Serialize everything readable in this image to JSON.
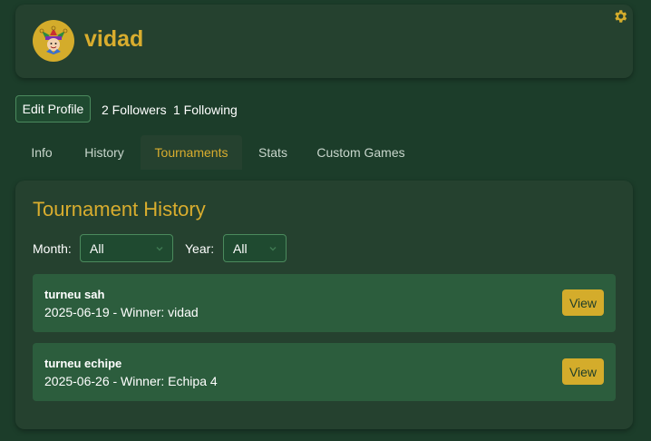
{
  "profile": {
    "username": "vidad",
    "avatar_icon": "jester-icon",
    "settings_icon": "gear-icon"
  },
  "actions": {
    "edit_profile_label": "Edit Profile",
    "followers": "2 Followers",
    "following": "1 Following"
  },
  "tabs": [
    {
      "label": "Info",
      "active": false
    },
    {
      "label": "History",
      "active": false
    },
    {
      "label": "Tournaments",
      "active": true
    },
    {
      "label": "Stats",
      "active": false
    },
    {
      "label": "Custom Games",
      "active": false
    }
  ],
  "panel": {
    "title": "Tournament History",
    "month_label": "Month:",
    "month_value": "All",
    "year_label": "Year:",
    "year_value": "All"
  },
  "tournaments": [
    {
      "name": "turneu sah",
      "meta": "2025-06-19 - Winner: vidad",
      "view_label": "View"
    },
    {
      "name": "turneu echipe",
      "meta": "2025-06-26 - Winner: Echipa 4",
      "view_label": "View"
    }
  ],
  "colors": {
    "background": "#1c3d2a",
    "card": "#25412f",
    "accent": "#d9ad2e",
    "row": "#2c5d3d"
  }
}
